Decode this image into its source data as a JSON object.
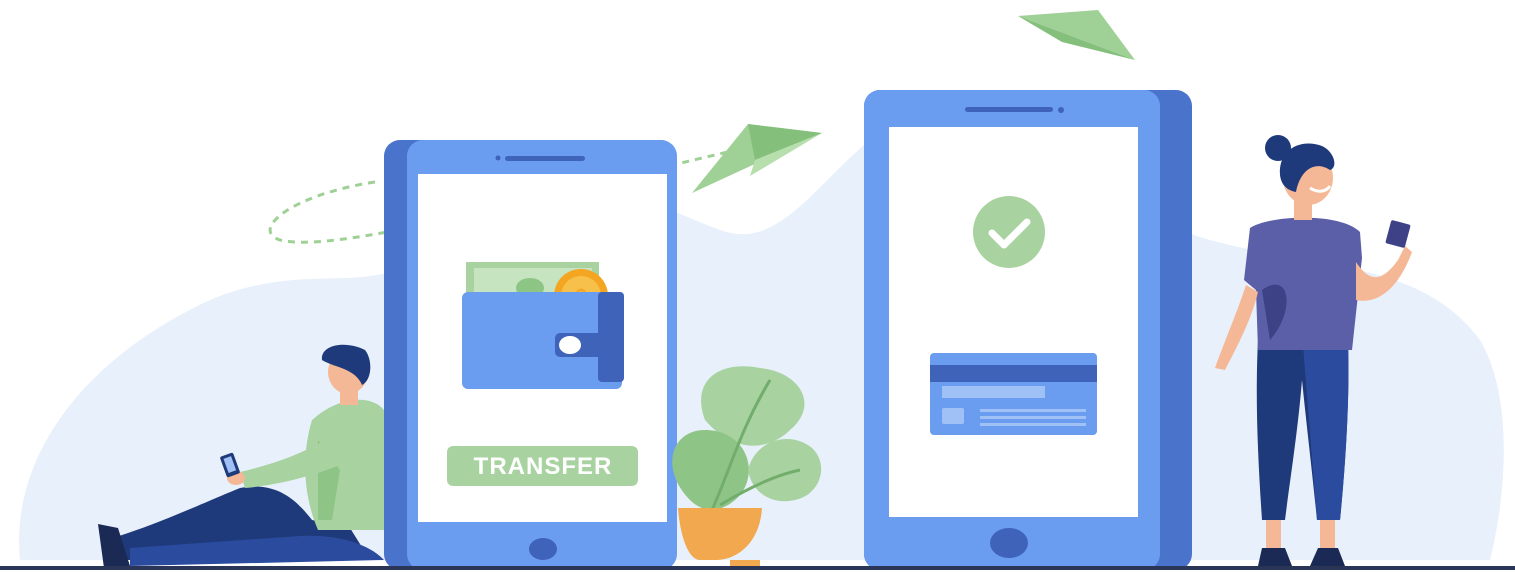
{
  "illustration": {
    "transfer_label": "TRANSFER",
    "currency_symbol": "$"
  },
  "icons": {
    "wallet": "wallet-icon",
    "coin": "coin-icon",
    "checkmark": "checkmark-icon",
    "card": "credit-card-icon",
    "paper_plane": "paper-plane-icon"
  },
  "colors": {
    "background_blob": "#e8f0fb",
    "device_blue": "#6a9cf0",
    "device_dark": "#4a74cc",
    "screen": "#ffffff",
    "accent_green": "#a8d3a0",
    "plant_pot": "#f2a84e",
    "ground_line": "#2b3555"
  }
}
